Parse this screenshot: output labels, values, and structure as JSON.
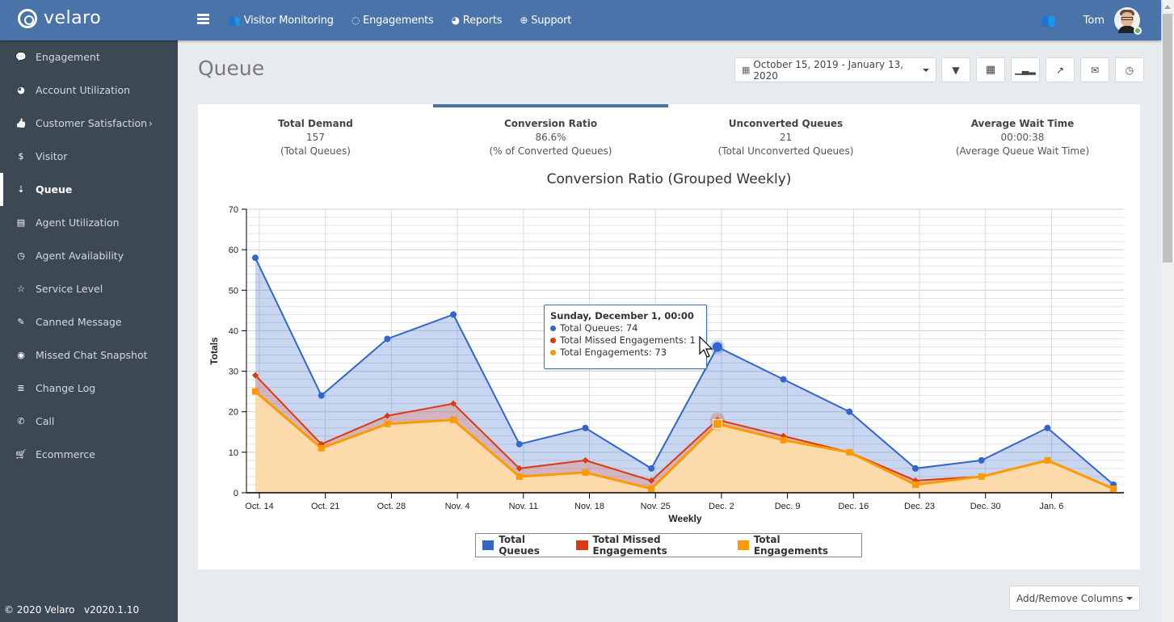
{
  "app": {
    "brand": "velaro",
    "footer": "© 2020 Velaro   v2020.1.10"
  },
  "topnav": {
    "items": [
      {
        "label": "Visitor Monitoring",
        "icon": "users-icon"
      },
      {
        "label": "Engagements",
        "icon": "comment-icon"
      },
      {
        "label": "Reports",
        "icon": "pie-chart-icon"
      },
      {
        "label": "Support",
        "icon": "life-ring-icon"
      }
    ],
    "user_name": "Tom",
    "user_status": "online"
  },
  "sidebar": {
    "items": [
      {
        "label": "Engagement",
        "icon": "comment-icon",
        "glyph": "💬"
      },
      {
        "label": "Account Utilization",
        "icon": "dashboard-icon",
        "glyph": "◕"
      },
      {
        "label": "Customer Satisfaction",
        "icon": "thumbs-up-icon",
        "glyph": "👍",
        "has_submenu": true
      },
      {
        "label": "Visitor",
        "icon": "dollar-icon",
        "glyph": "$"
      },
      {
        "label": "Queue",
        "icon": "sort-icon",
        "glyph": "⇣",
        "active": true
      },
      {
        "label": "Agent Utilization",
        "icon": "list-icon",
        "glyph": "▤"
      },
      {
        "label": "Agent Availability",
        "icon": "clock-icon",
        "glyph": "◷"
      },
      {
        "label": "Service Level",
        "icon": "star-icon",
        "glyph": "☆"
      },
      {
        "label": "Canned Message",
        "icon": "edit-icon",
        "glyph": "✎"
      },
      {
        "label": "Missed Chat Snapshot",
        "icon": "camera-icon",
        "glyph": "◉"
      },
      {
        "label": "Change Log",
        "icon": "database-icon",
        "glyph": "≣"
      },
      {
        "label": "Call",
        "icon": "phone-icon",
        "glyph": "✆"
      },
      {
        "label": "Ecommerce",
        "icon": "cart-icon",
        "glyph": "🛒"
      }
    ]
  },
  "page": {
    "title": "Queue",
    "date_range": "October 15, 2019 - January 13, 2020",
    "toolbar_buttons": [
      "filter-icon",
      "grid-icon",
      "bar-chart-icon",
      "share-icon",
      "envelope-icon",
      "clock-icon"
    ],
    "add_remove_columns": "Add/Remove Columns"
  },
  "kpis": [
    {
      "title": "Total Demand",
      "value": "157",
      "caption": "(Total Queues)"
    },
    {
      "title": "Conversion Ratio",
      "value": "86.6%",
      "caption": "(% of Converted Queues)",
      "active": true
    },
    {
      "title": "Unconverted Queues",
      "value": "21",
      "caption": "(Total Unconverted Queues)"
    },
    {
      "title": "Average Wait Time",
      "value": "00:00:38",
      "caption": "(Average Queue Wait Time)"
    }
  ],
  "tooltip": {
    "title": "Sunday, December 1, 00:00",
    "rows": [
      {
        "label": "Total Queues: 74",
        "color": "#3366cc"
      },
      {
        "label": "Total Missed Engagements: 1",
        "color": "#dc3912"
      },
      {
        "label": "Total Engagements: 73",
        "color": "#ff9900"
      }
    ]
  },
  "chart_data": {
    "type": "area",
    "title": "Conversion Ratio (Grouped Weekly)",
    "xlabel": "Weekly",
    "ylabel": "Totals",
    "ylim": [
      0,
      70
    ],
    "yticks": [
      0,
      10,
      20,
      30,
      40,
      50,
      60,
      70
    ],
    "grid": true,
    "legend_position": "bottom",
    "x_tick_labels": [
      "Oct. 14",
      "Oct. 21",
      "Oct. 28",
      "Nov. 4",
      "Nov. 11",
      "Nov. 18",
      "Nov. 25",
      "Dec. 2",
      "Dec. 9",
      "Dec. 16",
      "Dec. 23",
      "Dec. 30",
      "Jan. 6"
    ],
    "points_x": [
      "Oct 13",
      "Oct 20",
      "Oct 27",
      "Nov 3",
      "Nov 10",
      "Nov 17",
      "Nov 24",
      "Dec 1",
      "Dec 8",
      "Dec 15",
      "Dec 22",
      "Dec 29",
      "Jan 5",
      "Jan 12"
    ],
    "series": [
      {
        "name": "Total Queues",
        "color": "#3366cc",
        "marker": "circle",
        "values": [
          58,
          24,
          38,
          44,
          12,
          16,
          6,
          36,
          28,
          20,
          6,
          8,
          16,
          2
        ]
      },
      {
        "name": "Total Missed Engagements",
        "color": "#dc3912",
        "marker": "diamond",
        "values": [
          29,
          12,
          19,
          22,
          6,
          8,
          3,
          18,
          14,
          10,
          3,
          4,
          8,
          1
        ]
      },
      {
        "name": "Total Engagements",
        "color": "#ff9900",
        "marker": "square",
        "values": [
          25,
          11,
          17,
          18,
          4,
          5,
          1,
          17,
          13,
          10,
          2,
          4,
          8,
          1
        ]
      }
    ],
    "highlighted_index": 7
  }
}
